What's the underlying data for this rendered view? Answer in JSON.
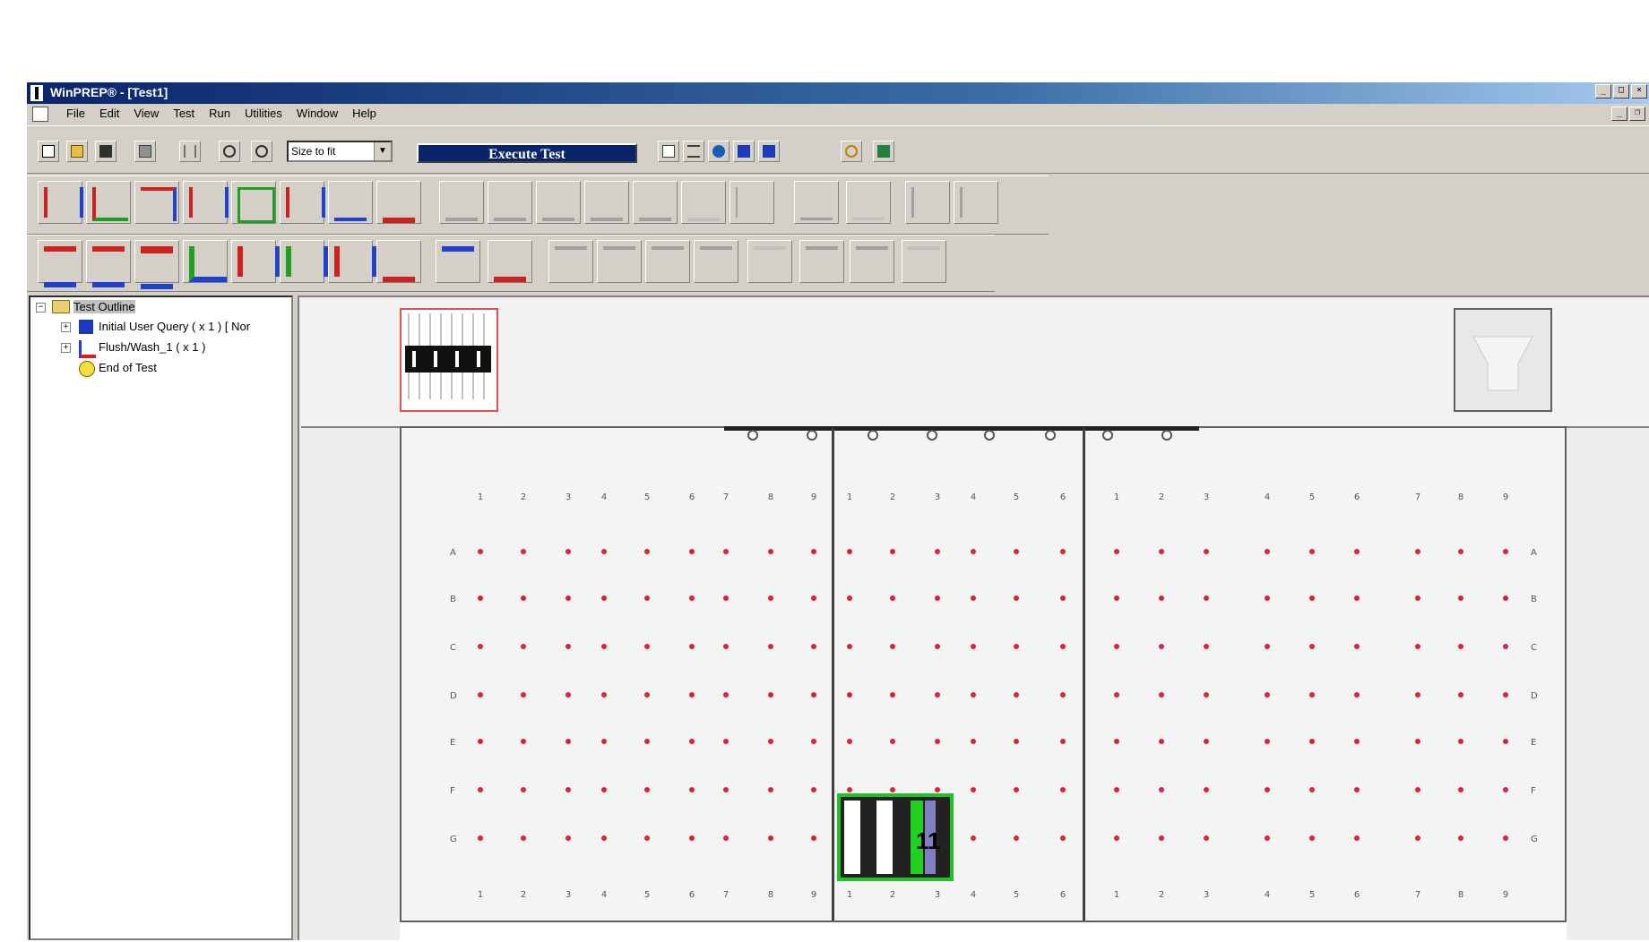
{
  "window": {
    "title": "WinPREP® - [Test1]",
    "controls": [
      "_",
      "□",
      "×"
    ],
    "mdi_controls": [
      "_",
      "❐",
      "×"
    ]
  },
  "menu": [
    "File",
    "Edit",
    "View",
    "Test",
    "Run",
    "Utilities",
    "Window",
    "Help"
  ],
  "toolbar": {
    "zoom_value": "Size to fit",
    "zoom_arrow": "▼",
    "execute_label": "Execute Test"
  },
  "tree": {
    "root": "Test Outline",
    "items": [
      {
        "label": "Initial User Query ( x 1 ) [ Nor",
        "expander": "+",
        "icon": "question-icon"
      },
      {
        "label": "Flush/Wash_1 ( x 1 )",
        "expander": "+",
        "icon": "flush-icon"
      },
      {
        "label": "End of Test",
        "expander": "",
        "icon": "end-bulb-icon"
      }
    ],
    "root_expander": "−"
  },
  "deck": {
    "row_letters": [
      "A",
      "B",
      "C",
      "D",
      "E",
      "F",
      "G"
    ],
    "plate1_cols": [
      "1",
      "2",
      "3",
      "4",
      "5",
      "6",
      "7",
      "8",
      "9"
    ],
    "plate2_cols": [
      "1",
      "2",
      "3",
      "4",
      "5",
      "6"
    ],
    "plate3_cols": [
      "1",
      "2",
      "3",
      "4",
      "5",
      "6",
      "7",
      "8",
      "9"
    ],
    "rack_label": "11"
  },
  "colors": {
    "title_start": "#0a246a",
    "title_end": "#a6caf0",
    "execute_bg": "#0a246a",
    "well_dot": "#e0203a",
    "rack_border": "#22c02a",
    "tip_holder_border": "#e05050"
  }
}
